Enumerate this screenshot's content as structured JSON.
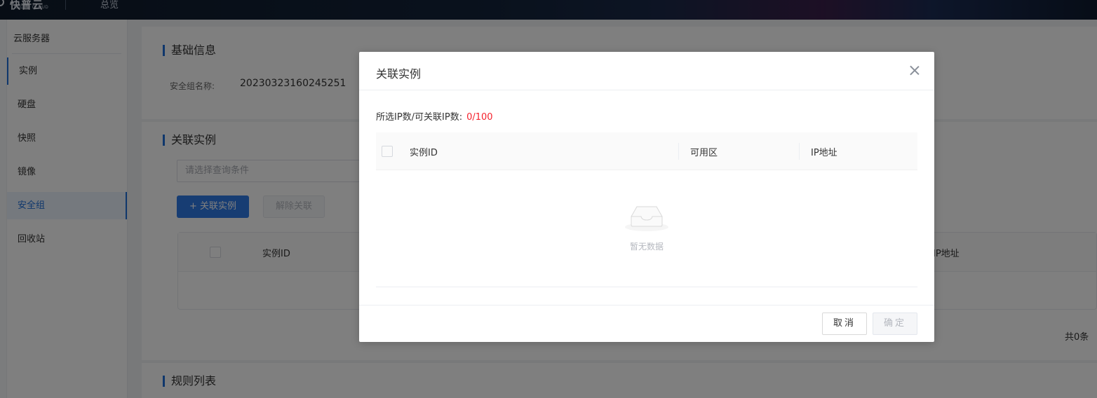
{
  "topbar": {
    "logo_text": "快普云",
    "logo_sub": "KAOPU CLOUD",
    "nav_item": "总览"
  },
  "sidebar": {
    "title": "云服务器",
    "items": [
      {
        "label": "实例"
      },
      {
        "label": "硬盘"
      },
      {
        "label": "快照"
      },
      {
        "label": "镜像"
      },
      {
        "label": "安全组",
        "active": true
      },
      {
        "label": "回收站"
      }
    ]
  },
  "main": {
    "basic_info": {
      "title": "基础信息",
      "name_label": "安全组名称:",
      "name_value": "20230323160245251"
    },
    "linked": {
      "title": "关联实例",
      "search_placeholder": "请选择查询条件",
      "add_button": "+ 关联实例",
      "remove_button": "解除关联",
      "columns": [
        "实例ID",
        "IP地址"
      ],
      "total": "共0条"
    },
    "rules": {
      "title": "规则列表"
    }
  },
  "dialog": {
    "title": "关联实例",
    "count_label": "所选IP数/可关联IP数:",
    "count_value": "0/100",
    "columns": [
      "实例ID",
      "可用区",
      "IP地址"
    ],
    "empty_text": "暂无数据",
    "cancel_label": "取消",
    "ok_label": "确定"
  },
  "colors": {
    "accent": "#1e6fd9",
    "danger": "#f5222d"
  }
}
